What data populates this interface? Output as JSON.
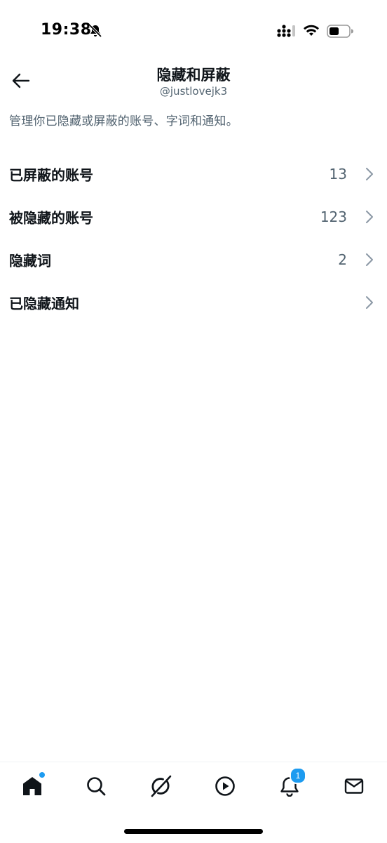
{
  "status_bar": {
    "time": "19:38"
  },
  "header": {
    "title": "隐藏和屏蔽",
    "subtitle": "@justlovejk3"
  },
  "description": "管理你已隐藏或屏蔽的账号、字词和通知。",
  "settings": {
    "items": [
      {
        "label": "已屏蔽的账号",
        "count": "13"
      },
      {
        "label": "被隐藏的账号",
        "count": "123"
      },
      {
        "label": "隐藏词",
        "count": "2"
      },
      {
        "label": "已隐藏通知",
        "count": ""
      }
    ]
  },
  "tab_bar": {
    "notifications_badge": "1"
  },
  "colors": {
    "text_primary": "#0f1419",
    "text_secondary": "#536471",
    "accent": "#1d9bf0"
  }
}
